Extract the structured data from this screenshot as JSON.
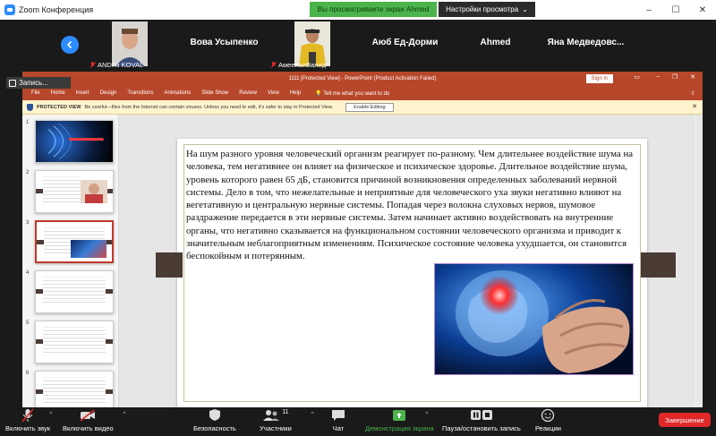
{
  "window": {
    "title": "Zoom Конференция",
    "share_banner": "Вы просматриваете экран Ahmed",
    "view_options_label": "Настройки просмотра",
    "minimize": "–",
    "maximize": "☐",
    "close": "✕"
  },
  "participants": [
    {
      "name": "ANDRii KOVAL",
      "has_video": true,
      "muted": true
    },
    {
      "name": "Вова Усыпенко",
      "has_video": false,
      "muted": false
    },
    {
      "name": "АмеенаиВалид",
      "has_video": true,
      "muted": true
    },
    {
      "name": "Аюб Ед-Дорми",
      "has_video": false,
      "muted": false
    },
    {
      "name": "Ahmed",
      "has_video": false,
      "muted": false
    },
    {
      "name": "Яна Медведовс...",
      "has_video": false,
      "muted": false
    }
  ],
  "recording": {
    "label": "Запись..."
  },
  "powerpoint": {
    "doc_title": "1111 [Protected View] - PowerPoint (Product Activation Failed)",
    "signin": "Sign in",
    "ribbon_tabs": [
      "File",
      "Home",
      "Insert",
      "Design",
      "Transitions",
      "Animations",
      "Slide Show",
      "Review",
      "View",
      "Help"
    ],
    "tell_me": "Tell me what you want to do",
    "protected_label": "PROTECTED VIEW",
    "protected_message": "Be careful—files from the Internet can contain viruses. Unless you need to edit, it's safer to stay in Protected View.",
    "enable_editing": "Enable Editing",
    "thumbnails": [
      "1",
      "2",
      "3",
      "4",
      "5",
      "6"
    ],
    "active_slide": 3,
    "slide_text": "На шум разного уровня человеческий организм реагирует по-разному. Чем длительнее воздействие шума на человека, тем негативнее он влияет на физическое и психическое здоровье. Длительное воздействие шума, уровень которого равен 65 дБ, становится причиной возникновения определенных заболеваний нервной системы. Дело в том, что нежелательные и неприятные для человеческого уха звуки негативно влияют на вегетативную и центральную нервные системы. Попадая через волокна слуховых нервов, шумовое раздражение передается в эти нервные системы. Затем начинает активно воздействовать на внутренние органы, что негативно сказывается на функциональном состоянии человеческого организма и приводит к значительным неблагоприятным изменениям. Психическое состояние человека ухудшается, он становится беспокойным и потерянным."
  },
  "toolbar": {
    "mute": "Включить звук",
    "video": "Включить видео",
    "security": "Безопасность",
    "participants": "Участники",
    "participants_count": "11",
    "chat": "Чат",
    "share": "Демонстрация экрана",
    "pause_stop": "Пауза/остановить запись",
    "reactions": "Реакции",
    "end": "Завершение"
  },
  "colors": {
    "zoom_blue": "#2d8cff",
    "ppt_red": "#b7472a",
    "share_green": "#4bb34b",
    "end_red": "#e02828"
  }
}
